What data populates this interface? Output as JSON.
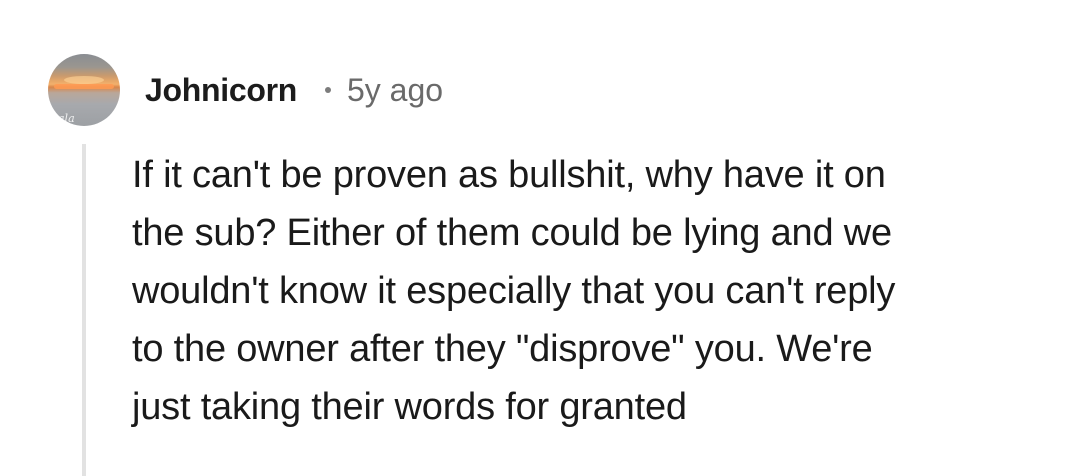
{
  "comment": {
    "author": "Johnicorn",
    "separator": "•",
    "timestamp": "5y ago",
    "avatar_icon": "sunset-avatar",
    "avatar_overlay_text": "ala",
    "body_lines": [
      "If it can't be proven as bullshit, why have it on",
      "the sub? Either of them could be lying and we",
      "wouldn't know it especially that you can't reply",
      "to the owner after they \"disprove\" you. We're",
      "just taking their words for granted"
    ]
  },
  "colors": {
    "background": "#ffffff",
    "text": "#1a1a1a",
    "meta_text": "#6a6a6a",
    "thread_line": "#e2e2e2"
  }
}
